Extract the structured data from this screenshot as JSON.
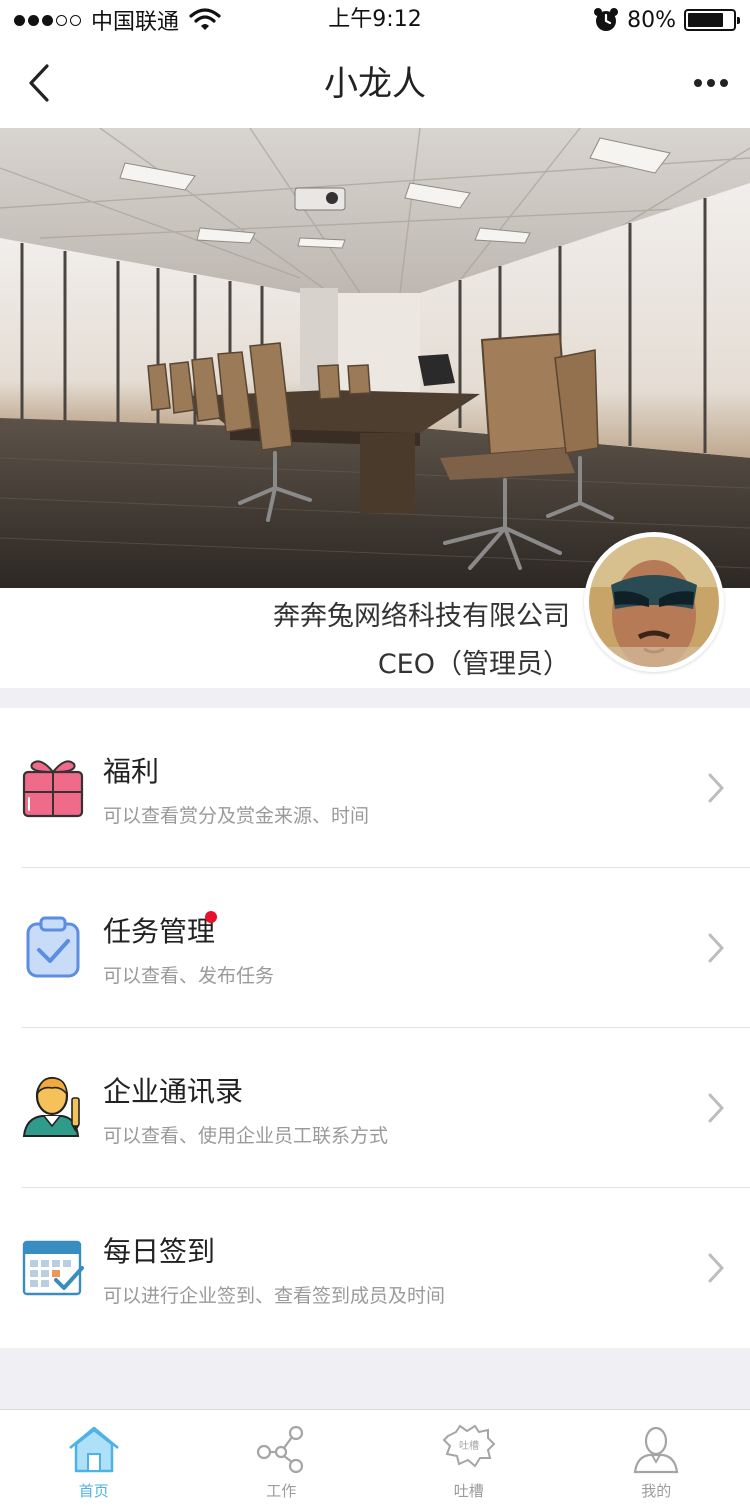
{
  "status_bar": {
    "carrier": "中国联通",
    "time": "上午9:12",
    "battery": "80%",
    "battery_level": 0.8
  },
  "nav": {
    "title": "小龙人"
  },
  "profile": {
    "company": "奔奔兔网络科技有限公司",
    "role": "CEO（管理员）"
  },
  "menu": {
    "items": [
      {
        "title": "福利",
        "subtitle": "可以查看赏分及赏金来源、时间",
        "icon": "gift-icon",
        "has_badge": false
      },
      {
        "title": "任务管理",
        "subtitle": "可以查看、发布任务",
        "icon": "clipboard-check-icon",
        "has_badge": true
      },
      {
        "title": "企业通讯录",
        "subtitle": "可以查看、使用企业员工联系方式",
        "icon": "contact-person-icon",
        "has_badge": false
      },
      {
        "title": "每日签到",
        "subtitle": "可以进行企业签到、查看签到成员及时间",
        "icon": "calendar-check-icon",
        "has_badge": false
      }
    ]
  },
  "tabbar": {
    "tabs": [
      {
        "label": "首页",
        "icon": "home-icon",
        "active": true
      },
      {
        "label": "工作",
        "icon": "share-network-icon",
        "active": false
      },
      {
        "label": "吐槽",
        "icon": "speech-burst-icon",
        "active": false
      },
      {
        "label": "我的",
        "icon": "user-icon",
        "active": false
      }
    ]
  },
  "colors": {
    "accent": "#4db2e6",
    "badge": "#e8102b",
    "gift": "#f06a8a",
    "task": "#5b8de0",
    "calendar": "#3a8dc0",
    "background": "#efeff4"
  }
}
